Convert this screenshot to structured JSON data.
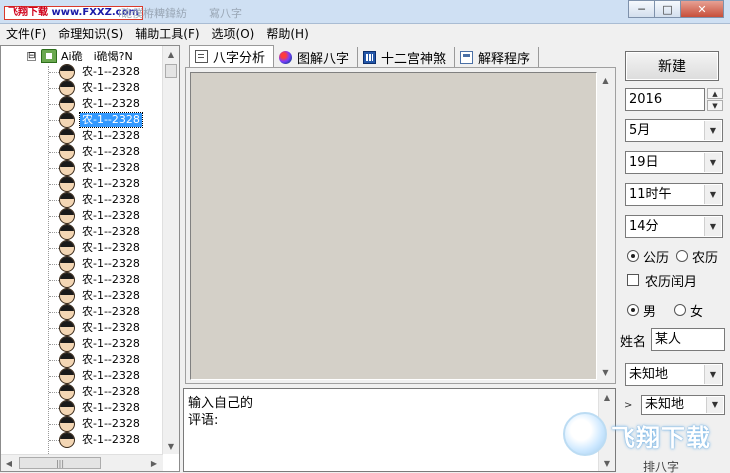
{
  "window": {
    "title_text": "i硊僕栫粺鍏紡　　寫八字　　　　　　　　",
    "watermark_brand": "飞翔下载",
    "watermark_url": "www.FXXZ.com",
    "minimize": "─",
    "maximize": "□",
    "close": "✕"
  },
  "menu": [
    {
      "label": "文件(F)"
    },
    {
      "label": "命理知识(S)"
    },
    {
      "label": "辅助工具(F)"
    },
    {
      "label": "选项(O)"
    },
    {
      "label": "帮助(H)"
    }
  ],
  "tree": {
    "toggle": "⊟",
    "root_label": "Ai硊　i硊愒?N",
    "items": [
      {
        "label": "农-1--2328"
      },
      {
        "label": "农-1--2328"
      },
      {
        "label": "农-1--2328"
      },
      {
        "label": "农-1--2328"
      },
      {
        "label": "农-1--2328"
      },
      {
        "label": "农-1--2328"
      },
      {
        "label": "农-1--2328"
      },
      {
        "label": "农-1--2328"
      },
      {
        "label": "农-1--2328"
      },
      {
        "label": "农-1--2328"
      },
      {
        "label": "农-1--2328"
      },
      {
        "label": "农-1--2328"
      },
      {
        "label": "农-1--2328"
      },
      {
        "label": "农-1--2328"
      },
      {
        "label": "农-1--2328"
      },
      {
        "label": "农-1--2328"
      },
      {
        "label": "农-1--2328"
      },
      {
        "label": "农-1--2328"
      },
      {
        "label": "农-1--2328"
      },
      {
        "label": "农-1--2328"
      },
      {
        "label": "农-1--2328"
      },
      {
        "label": "农-1--2328"
      },
      {
        "label": "农-1--2328"
      },
      {
        "label": "农-1--2328"
      }
    ],
    "selected_index": 3,
    "hscroll_grip": "|||"
  },
  "tabs": [
    {
      "label": "八字分析",
      "icon": "document-icon"
    },
    {
      "label": "图解八字",
      "icon": "paint-icon"
    },
    {
      "label": "十二宫神煞",
      "icon": "grid-icon"
    },
    {
      "label": "解释程序",
      "icon": "program-icon"
    }
  ],
  "comment_box": {
    "line1": "输入自己的",
    "line2": "评语:"
  },
  "controls": {
    "new_button": "新建",
    "year": "2016",
    "month": "5月",
    "day": "19日",
    "hour": "11时午",
    "minute": "14分",
    "calendar_solar": "公历",
    "calendar_lunar": "农历",
    "calendar_selected": "solar",
    "leap_month_label": "农历闰月",
    "gender_male": "男",
    "gender_female": "女",
    "gender_selected": "male",
    "name_label": "姓名",
    "name_value": "某人",
    "place1": "未知地",
    "place2": "未知地",
    "arrange_label": "排八字"
  },
  "badge": {
    "text": "飞翔下载"
  }
}
